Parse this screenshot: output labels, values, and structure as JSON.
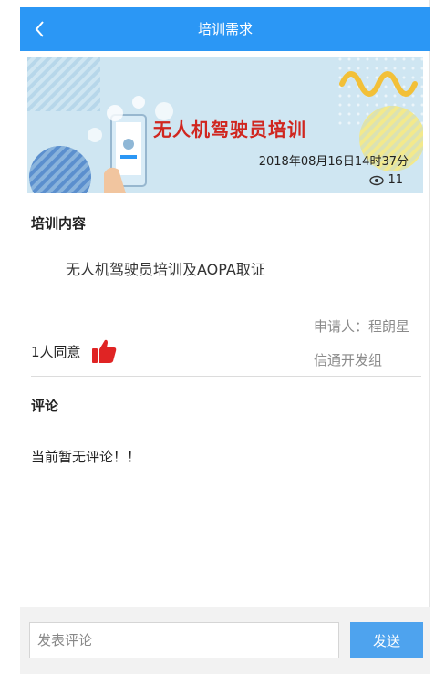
{
  "header": {
    "title": "培训需求",
    "back_icon": "chevron-left-icon",
    "background_color": "#2b97f5"
  },
  "banner": {
    "title": "无人机驾驶员培训",
    "date": "2018年08月16日14时37分",
    "views": "11",
    "views_icon": "eye-icon",
    "title_color": "#d0261f"
  },
  "content": {
    "section_title": "培训内容",
    "text": "无人机驾驶员培训及AOPA取证"
  },
  "meta": {
    "applicant": "申请人：程朗星",
    "group": "信通开发组",
    "agree_text": "1人同意",
    "agree_icon": "thumbs-up-icon",
    "agree_icon_color": "#e02424"
  },
  "comments": {
    "section_title": "评论",
    "empty_text": "当前暂无评论！！"
  },
  "footer": {
    "input_placeholder": "发表评论",
    "send_label": "发送",
    "send_color": "#4ea3ee"
  }
}
